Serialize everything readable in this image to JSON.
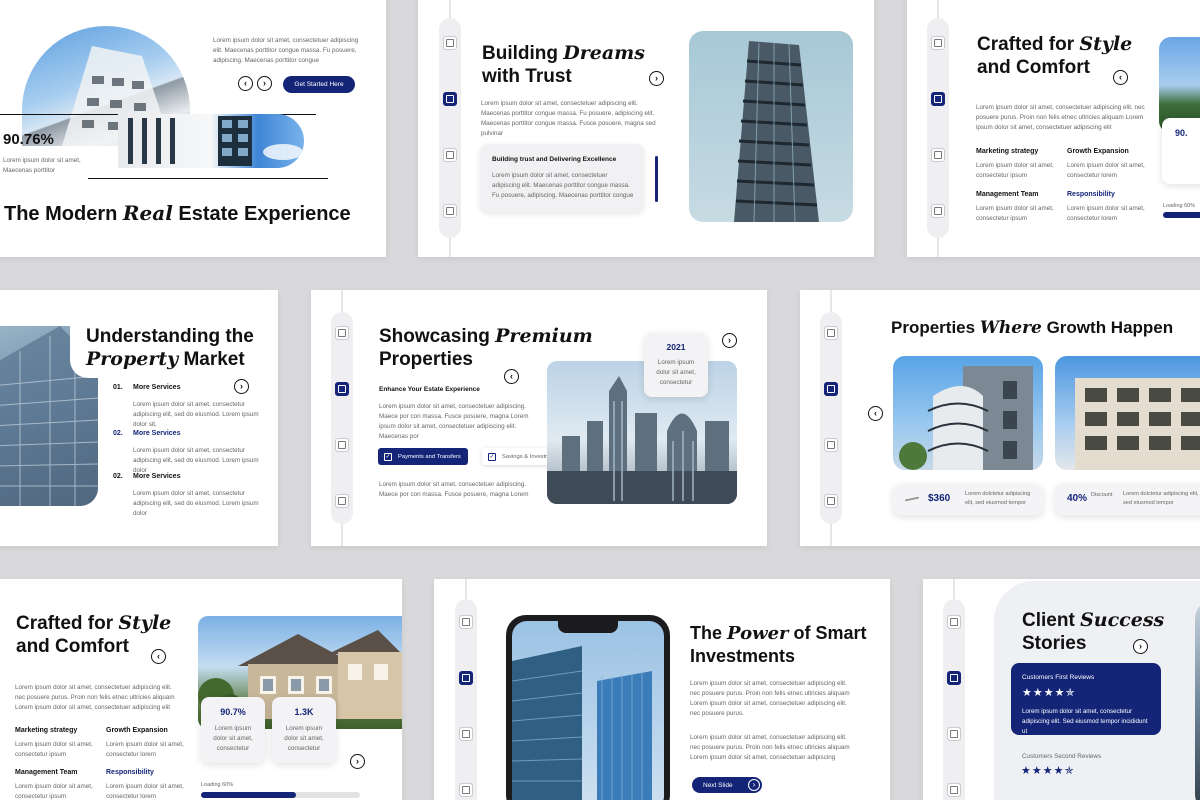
{
  "colors": {
    "navy": "#142578",
    "sky": "#4d8fd8",
    "background": "#d9d9db"
  },
  "lorem": {
    "short": "Lorem ipsum dolor sit amet,",
    "hero_desc": "Lorem ipsum dolor sit amet, consectetuer adipiscing elit. Maecenas porttitor congue massa. Fu posuere, adipiscing. Maecenas porttitor congue",
    "para3": "Lorem ipsum dolor sit amet, consectetuer adipiscing elit. Maecenas porttitor congue massa. Fu posuere, adipiscing elit. Maecenas porttitor congue massa. Fusce posuere, magna sed pulvinar",
    "para_crafted": "Lorem ipsum dolor sit amet, consectetuer adipiscing elit. nec posuere purus. Proin non felis etnec ultricies aliquam Lorem ipsum dolor sit amet, consectetuer adipiscing elit",
    "two_line": "Lorem ipsum dolor sit amet, consectetur ipsum",
    "services": "Lorem ipsum dolor sit amet, consectetur adipiscing elit, sed do eiusmod. Lorem ipsum dolor sit,"
  },
  "slide1": {
    "desc": "Lorem ipsum dolor sit amet, consectetuer adipiscing elit. Maecenas porttitor congue massa. Fu posuere, adipiscing. Maecenas porttitor congue",
    "cta": "Get Started Here",
    "stat": "90.76%",
    "stat_desc": "Lorem ipsum dolor sit amet, Maecenas porttitor",
    "title_a": "The Modern ",
    "title_em": "Real",
    "title_b": " Estate Experience"
  },
  "slide2": {
    "title_a": "Building ",
    "title_em": "Dreams",
    "title_b": "with Trust",
    "desc": "Lorem ipsum dolor sit amet, consectetuer adipiscing elit. Maecenas porttitor congue massa. Fu posuere, adipiscing elit. Maecenas porttitor congue massa. Fusce posuere, magna sed pulvinar",
    "card_title": "Building trust and Delivering Excellence",
    "card_desc": "Lorem ipsum dolor sit amet, consectetuer adipiscing elit. Maecenas porttitor congue massa. Fu posuere, adipiscing. Maecenas porttitor congue"
  },
  "slide3": {
    "title_a": "Crafted for ",
    "title_em": "Style",
    "title_b": "and Comfort",
    "desc": "Lorem ipsum dolor sit amet, consectetuer adipiscing elit. nec posuere purus. Proin non felis etnec ultricies aliquam Lorem ipsum dolor sit amet, consectetuer adipiscing elit",
    "items": [
      {
        "label": "Marketing strategy",
        "text": "Lorem ipsum dolor sit amet, consectetur ipsum"
      },
      {
        "label": "Growth Expansion",
        "text": "Lorem ipsum dolor sit amet, consectetur lorem"
      },
      {
        "label": "Management Team",
        "text": "Lorem ipsum dolor sit amet, consectetur ipsum"
      },
      {
        "label": "Responsibility",
        "text": "Lorem ipsum dolor sit amet, consectetur lorem"
      }
    ],
    "stat": "90.",
    "loading": "Loading 60%"
  },
  "slide4": {
    "title_a": "Understanding the",
    "title_em": "Property",
    "title_b": " Market",
    "services": [
      {
        "num": "01.",
        "label": "More Services",
        "text": "Lorem ipsum dolor sit amet, consectetur adipiscing elit, sed do eiusmod. Lorem ipsum dolor sit,"
      },
      {
        "num": "02.",
        "label": "More Services",
        "text": "Lorem ipsum dolor sit amet, consectetur adipiscing elit, sed do eiusmod. Lorem ipsum dolor"
      },
      {
        "num": "02.",
        "label": "More Services",
        "text": "Lorem ipsum dolor sit amet, consectetur adipiscing elit, sed do eiusmod. Lorem ipsum dolor"
      }
    ]
  },
  "slide5": {
    "title_a": "Showcasing ",
    "title_em": "Premium",
    "title_b": "Properties",
    "subtitle": "Enhance Your Estate Experience",
    "desc": "Lorem ipsum dolor sit amet, consectetuer adipiscing. Maece por con massa. Fusce posuere, magna Lorem ipsum dolor sit amet, consectetuer adipiscing elit. Maecenas por",
    "year": "2021",
    "year_desc": "Lorem ipsum dolor sit amet, consectetur",
    "chip1": "Payments and Transfers",
    "chip2": "Savings & Investments",
    "desc2": "Lorem ipsum dolor sit amet, consectetuer adipiscing. Maece por con massa. Fusce posuere, magna Lorem"
  },
  "slide6": {
    "title_a": "Properties ",
    "title_em": "Where",
    "title_b": " Growth Happen",
    "price": "$360",
    "price_desc": "Lorem dolctetur adipiscing elit, sed eiusmod tempor",
    "pct": "40%",
    "discount": "Discount",
    "pct_desc": "Lorem dolctetur adipiscing elit, sed eiusmod tempor"
  },
  "slide7": {
    "title_a": "Crafted for ",
    "title_em": "Style",
    "title_b": "and Comfort",
    "desc": "Lorem ipsum dolor sit amet, consectetuer adipiscing elit. nec posuere purus. Proin non felis etnec ultricies aliquam Lorem ipsum dolor sit amet, consectetuer adipiscing elit",
    "items": [
      {
        "label": "Marketing strategy",
        "text": "Lorem ipsum dolor sit amet, consectetur ipsum"
      },
      {
        "label": "Growth Expansion",
        "text": "Lorem ipsum dolor sit amet, consectetur lorem"
      },
      {
        "label": "Management Team",
        "text": "Lorem ipsum dolor sit amet, consectetur ipsum"
      },
      {
        "label": "Responsibility",
        "text": "Lorem ipsum dolor sit amet, consectetur lorem"
      }
    ],
    "stat1": "90.7%",
    "stat1_desc": "Lorem ipsum dolor sit amet, consectetur",
    "stat2": "1.3K",
    "stat2_desc": "Lorem ipsum dolor sit amet, consectetur",
    "loading": "Loading 60%",
    "progress": 0.6
  },
  "slide8": {
    "title_a": "The ",
    "title_em": "Power",
    "title_b": " of Smart",
    "title_c": "Investments",
    "desc": "Lorem ipsum dolor sit amet, consectetuer adipiscing elit. nec posuere purus. Proin non felis etnec ultricies aliquam Lorem ipsum dolor sit amet, consectetuer adipiscing elit. nec posuere purus.",
    "desc2": "Lorem ipsum dolor sit amet, consectetuer adipiscing elit. nec posuere purus. Proin non felis etnec ultricies aliquam Lorem ipsum dolor sit amet, consectetuer adipiscing",
    "next": "Next Slide"
  },
  "slide9": {
    "title_a": "Client ",
    "title_em": "Success",
    "title_b": "Stories",
    "review1_title": "Customers First Reviews",
    "review1_stars": "★★★★✯",
    "review1_text": "Lorem ipsum dolor sit amet, consectetur adipiscing elit. Sed eiusmod tempor incididunt ut",
    "review2_title": "Customers Second Reviews",
    "review2_stars": "★★★★✯"
  }
}
